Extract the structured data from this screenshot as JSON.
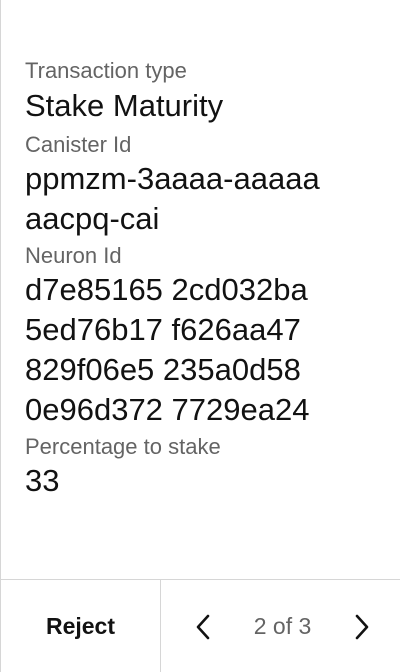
{
  "fields": {
    "transaction_type": {
      "label": "Transaction type",
      "value": "Stake Maturity"
    },
    "canister_id": {
      "label": "Canister Id",
      "lines": [
        "ppmzm-3aaaa-aaaaa",
        "aacpq-cai"
      ]
    },
    "neuron_id": {
      "label": "Neuron Id",
      "lines": [
        "d7e85165 2cd032ba",
        "5ed76b17 f626aa47",
        "829f06e5 235a0d58",
        "0e96d372 7729ea24"
      ]
    },
    "percentage_to_stake": {
      "label": "Percentage to stake",
      "value": "33"
    }
  },
  "footer": {
    "reject_label": "Reject",
    "page_indicator": "2 of 3",
    "prev_icon": "chevron-left-icon",
    "next_icon": "chevron-right-icon"
  },
  "colors": {
    "text_primary": "#121212",
    "text_secondary": "#646464",
    "divider": "#d6d6d6",
    "background": "#ffffff"
  }
}
